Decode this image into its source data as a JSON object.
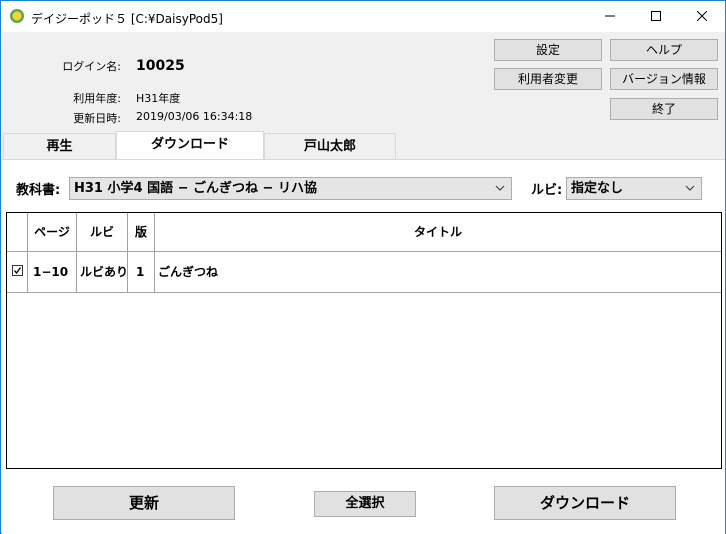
{
  "window": {
    "title": "デイジーポッド５ [C:¥DaisyPod5]",
    "minimize_glyph": "—",
    "maximize_glyph": "☐",
    "close_glyph": "✕"
  },
  "header": {
    "login_label": "ログイン名:",
    "login_value": "10025",
    "year_label": "利用年度:",
    "year_value": "H31年度",
    "updated_label": "更新日時:",
    "updated_value": "2019/03/06 16:34:18"
  },
  "buttons": {
    "settings": "設定",
    "help": "ヘルプ",
    "change_user": "利用者変更",
    "version_info": "バージョン情報",
    "exit": "終了",
    "refresh": "更新",
    "select_all": "全選択",
    "download": "ダウンロード"
  },
  "tabs": [
    {
      "label": "再生"
    },
    {
      "label": "ダウンロード"
    },
    {
      "label": "戸山太郎"
    }
  ],
  "filters": {
    "textbook_label": "教科書:",
    "textbook_value": "H31  小学4  国語 − ごんぎつね − リハ協",
    "ruby_label": "ルビ:",
    "ruby_value": "指定なし"
  },
  "table": {
    "columns": [
      "ページ",
      "ルビ",
      "版",
      "タイトル"
    ],
    "rows": [
      {
        "checked": true,
        "page": "1−10",
        "ruby": "ルビあり",
        "edition": "1",
        "title": "ごんぎつね"
      }
    ]
  },
  "icons": {
    "app": "daisy-flower-icon",
    "dropdown": "chevron-down-icon",
    "checkbox": "checkbox-checked-icon"
  }
}
